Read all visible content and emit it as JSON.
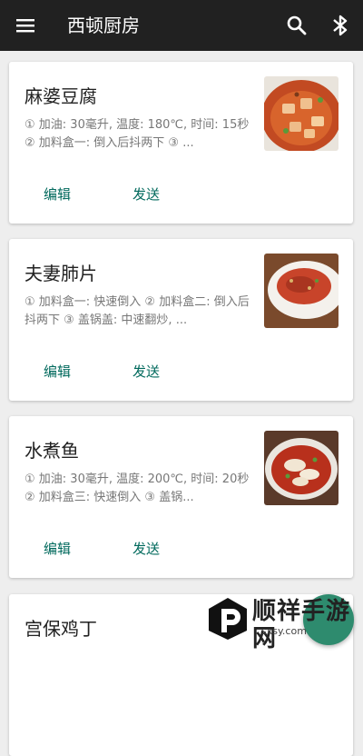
{
  "app": {
    "title": "西顿厨房"
  },
  "icons": {
    "menu": "menu-icon",
    "search": "search-icon",
    "bluetooth": "bluetooth-icon"
  },
  "colors": {
    "appbar": "#212121",
    "accent": "#00695c",
    "fab": "#2e8b6e"
  },
  "recipes": [
    {
      "name": "麻婆豆腐",
      "desc": "① 加油: 30毫升, 温度: 180℃, 时间: 15秒 ② 加料盒一: 倒入后抖两下 ③ ...",
      "edit_label": "编辑",
      "send_label": "发送"
    },
    {
      "name": "夫妻肺片",
      "desc": "① 加料盒一: 快速倒入 ② 加料盒二: 倒入后抖两下 ③ 盖锅盖: 中速翻炒, ...",
      "edit_label": "编辑",
      "send_label": "发送"
    },
    {
      "name": "水煮鱼",
      "desc": "① 加油: 30毫升, 温度: 200℃, 时间: 20秒 ② 加料盒三: 快速倒入 ③ 盖锅...",
      "edit_label": "编辑",
      "send_label": "发送"
    },
    {
      "name": "宫保鸡丁"
    }
  ],
  "watermark": {
    "text": "顺祥手游网",
    "url": "sxsy.com"
  }
}
